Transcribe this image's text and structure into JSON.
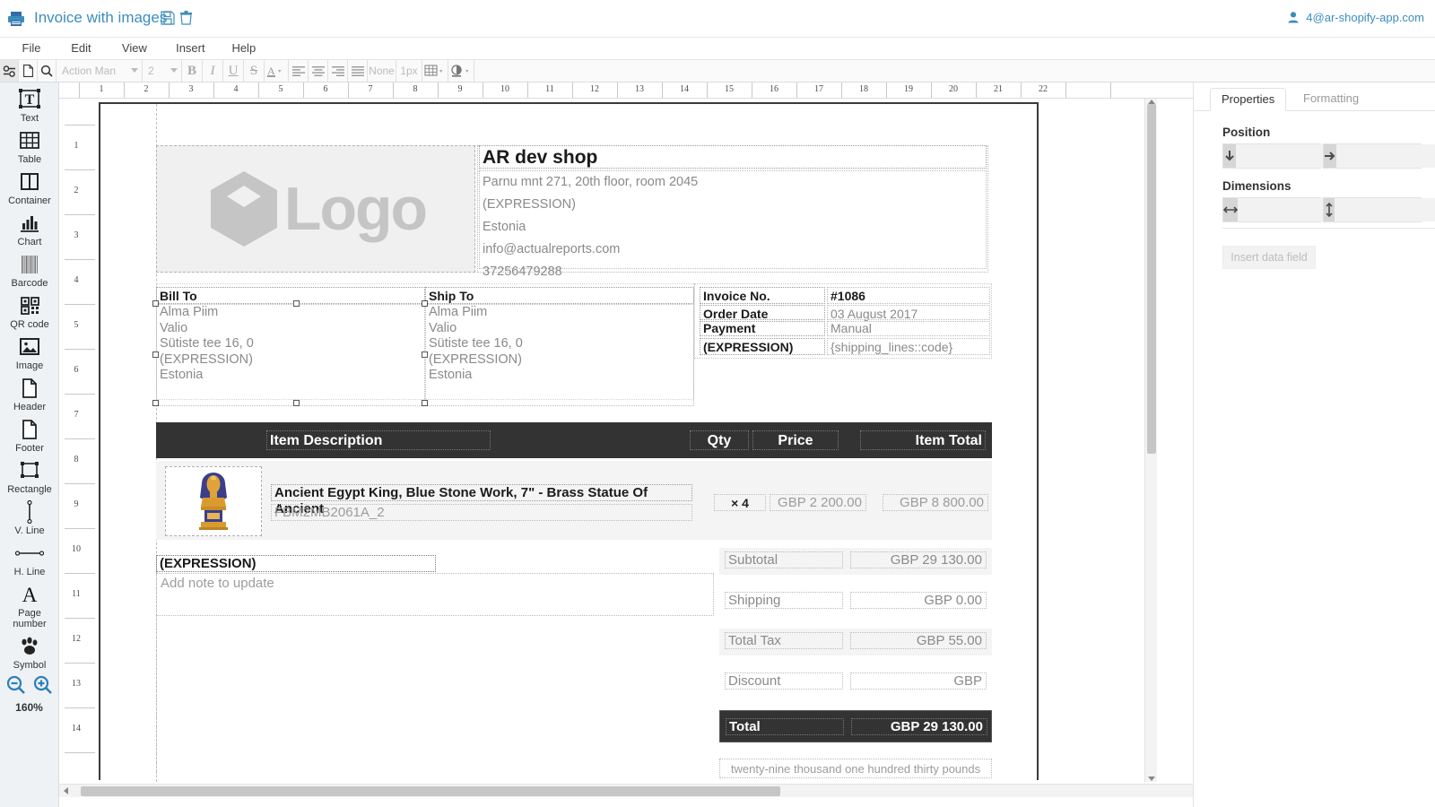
{
  "topbar": {
    "title": "Invoice with images",
    "printer_icon": "printer-icon",
    "save_icon": "save-icon",
    "delete_icon": "trash-icon",
    "user_email": "4@ar-shopify-app.com",
    "accent_color": "#3c8dbc"
  },
  "menubar": {
    "items": [
      "File",
      "Edit",
      "View",
      "Insert",
      "Help"
    ]
  },
  "format_toolbar": {
    "font_family": "Action Man",
    "font_size": "2",
    "border_style": "None",
    "border_width": "1px",
    "buttons": [
      "settings-icon",
      "page-icon",
      "search-icon"
    ],
    "style_buttons": [
      "bold",
      "italic",
      "underline",
      "strikethrough",
      "text-color"
    ],
    "align_buttons": [
      "align-left",
      "align-center",
      "align-right",
      "align-justify"
    ],
    "table_button": "table-borders-icon",
    "fill_button": "fill-color-icon"
  },
  "sidebar": {
    "tools": [
      {
        "label": "Text",
        "icon": "text-tool-icon"
      },
      {
        "label": "Table",
        "icon": "table-tool-icon"
      },
      {
        "label": "Container",
        "icon": "container-tool-icon"
      },
      {
        "label": "Chart",
        "icon": "chart-tool-icon"
      },
      {
        "label": "Barcode",
        "icon": "barcode-tool-icon"
      },
      {
        "label": "QR code",
        "icon": "qrcode-tool-icon"
      },
      {
        "label": "Image",
        "icon": "image-tool-icon"
      },
      {
        "label": "Header",
        "icon": "header-tool-icon"
      },
      {
        "label": "Footer",
        "icon": "footer-tool-icon"
      },
      {
        "label": "Rectangle",
        "icon": "rectangle-tool-icon"
      },
      {
        "label": "V. Line",
        "icon": "vertical-line-tool-icon"
      },
      {
        "label": "H. Line",
        "icon": "horizontal-line-tool-icon"
      },
      {
        "label": "Page number",
        "icon": "page-number-tool-icon"
      },
      {
        "label": "Symbol",
        "icon": "symbol-paw-tool-icon"
      }
    ],
    "zoom_out_icon": "zoom-out-icon",
    "zoom_in_icon": "zoom-in-icon",
    "zoom_level": "160%"
  },
  "rulers": {
    "horizontal": [
      "1",
      "2",
      "3",
      "4",
      "5",
      "6",
      "7",
      "8",
      "9",
      "10",
      "11",
      "12",
      "13",
      "14",
      "15",
      "16",
      "17",
      "18",
      "19",
      "20",
      "21",
      "22"
    ],
    "vertical": [
      "1",
      "2",
      "3",
      "4",
      "5",
      "6",
      "7",
      "8",
      "9",
      "10",
      "11",
      "12",
      "13",
      "14"
    ]
  },
  "document": {
    "logo_placeholder": "Logo",
    "company": {
      "name": "AR dev shop",
      "address_lines": [
        "Parnu mnt 271, 20th floor, room 2045",
        "(EXPRESSION)",
        "Estonia",
        "info@actualreports.com",
        "37256479288"
      ]
    },
    "bill_to": {
      "heading": "Bill To",
      "lines": [
        "Alma Piim",
        "Valio",
        "Sütiste tee 16, 0",
        "(EXPRESSION)",
        "Estonia"
      ]
    },
    "ship_to": {
      "heading": "Ship To",
      "lines": [
        "Alma Piim",
        "Valio",
        "Sütiste tee 16, 0",
        "(EXPRESSION)",
        "Estonia"
      ]
    },
    "invoice_meta": [
      {
        "label": "Invoice No.",
        "value": "#1086",
        "value_style": "dark"
      },
      {
        "label": "Order Date",
        "value": "03 August 2017",
        "value_style": "muted"
      },
      {
        "label": "Payment",
        "value": "Manual",
        "value_style": "muted"
      },
      {
        "label": "(EXPRESSION)",
        "value": "{shipping_lines::code}",
        "value_style": "muted"
      }
    ],
    "item_table": {
      "headers": [
        "Item Description",
        "Qty",
        "Price",
        "Item Total"
      ],
      "rows": [
        {
          "image": "pharaoh-statue-thumbnail",
          "description": "Ancient Egypt King, Blue Stone Work, 7\" - Brass Statue Of Ancient",
          "sku": "FBM2MB2061A_2",
          "qty": "× 4",
          "price": "GBP 2 200.00",
          "total": "GBP 8 800.00"
        }
      ]
    },
    "note": {
      "expression": "(EXPRESSION)",
      "placeholder": "Add note to update"
    },
    "totals": [
      {
        "label": "Subtotal",
        "value": "GBP 29 130.00",
        "style": "shade"
      },
      {
        "label": "Shipping",
        "value": "GBP 0.00",
        "style": "plain"
      },
      {
        "label": "Total Tax",
        "value": "GBP 55.00",
        "style": "shade"
      },
      {
        "label": "Discount",
        "value": "GBP",
        "style": "plain"
      },
      {
        "label": "Total",
        "value": "GBP 29 130.00",
        "style": "dark"
      }
    ],
    "amount_in_words": "twenty-nine thousand one hundred thirty pounds"
  },
  "properties_panel": {
    "tabs": [
      {
        "label": "Properties",
        "selected": true
      },
      {
        "label": "Formatting",
        "selected": false
      }
    ],
    "groups": [
      {
        "label": "Position",
        "fields": [
          {
            "icon": "arrow-down-icon",
            "value": ""
          },
          {
            "icon": "arrow-right-icon",
            "value": ""
          }
        ]
      },
      {
        "label": "Dimensions",
        "fields": [
          {
            "icon": "arrow-horizontal-icon",
            "value": ""
          },
          {
            "icon": "arrow-vertical-icon",
            "value": ""
          }
        ]
      }
    ],
    "insert_button": "Insert data field"
  }
}
